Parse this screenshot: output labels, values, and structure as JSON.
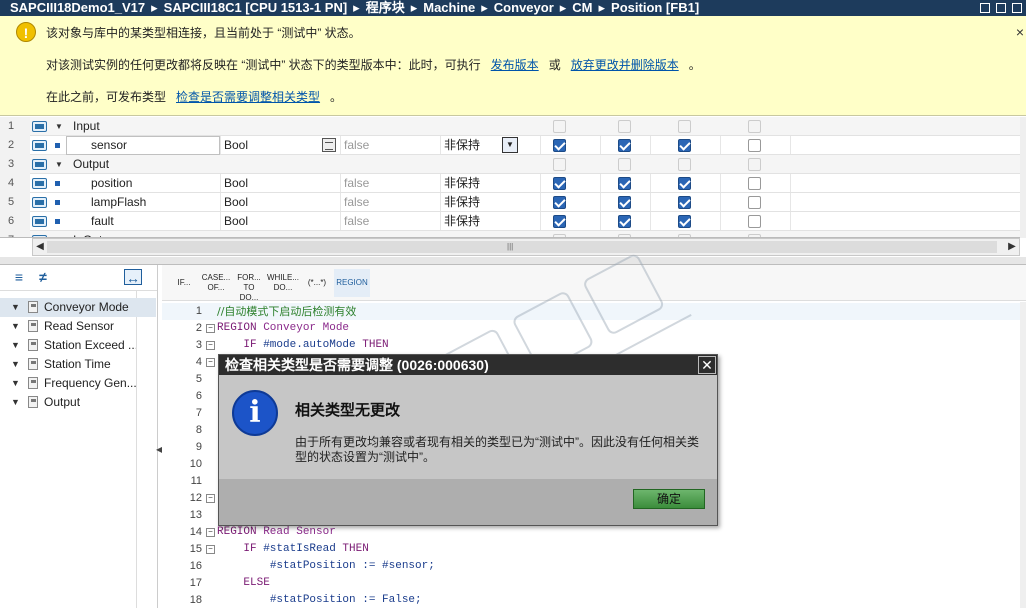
{
  "titlebar": {
    "crumbs": [
      "SAPCIII18Demo1_V17",
      "SAPCIII18C1 [CPU 1513-1 PN]",
      "程序块",
      "Machine",
      "Conveyor",
      "CM",
      "Position [FB1]"
    ],
    "separator": "▸",
    "window_buttons": [
      "minimize",
      "restore",
      "maximize"
    ]
  },
  "banner": {
    "icon": "warning-icon",
    "line1": "该对象与库中的某类型相连接，且当前处于 “测试中” 状态。",
    "line2_text": "对该测试实例的任何更改都将反映在 “测试中” 状态下的类型版本中：此时，可执行",
    "line2_link1": "发布版本",
    "line2_or": "或",
    "line2_link2": "放弃更改并删除版本",
    "line2_end": "。",
    "line3_text": "在此之前，可发布类型",
    "line3_link": "检查是否需要调整相关类型",
    "line3_end": "。",
    "close": "×"
  },
  "interface": {
    "rows": [
      {
        "num": "1",
        "name": "Input",
        "section": true
      },
      {
        "num": "2",
        "name": "sensor",
        "type": "Bool",
        "default": "false",
        "retain": "非保持",
        "checks": [
          true,
          true,
          true
        ],
        "selected": true
      },
      {
        "num": "3",
        "name": "Output",
        "section": true
      },
      {
        "num": "4",
        "name": "position",
        "type": "Bool",
        "default": "false",
        "retain": "非保持",
        "checks": [
          true,
          true,
          true
        ]
      },
      {
        "num": "5",
        "name": "lampFlash",
        "type": "Bool",
        "default": "false",
        "retain": "非保持",
        "checks": [
          true,
          true,
          true
        ]
      },
      {
        "num": "6",
        "name": "fault",
        "type": "Bool",
        "default": "false",
        "retain": "非保持",
        "checks": [
          true,
          true,
          true
        ]
      },
      {
        "num": "7",
        "name": "InOut",
        "section": true
      }
    ],
    "scroll_grip": "|||"
  },
  "nav": {
    "items": [
      "Conveyor Mode",
      "Read Sensor",
      "Station Exceed ...",
      "Station Time",
      "Frequency Gen...",
      "Output"
    ]
  },
  "editor_toolbar": {
    "buttons": [
      {
        "l1": "IF...",
        "l2": ""
      },
      {
        "l1": "CASE...",
        "l2": "OF..."
      },
      {
        "l1": "FOR...",
        "l2": "TO DO..."
      },
      {
        "l1": "WHILE...",
        "l2": "DO..."
      },
      {
        "l1": "(*...*)",
        "l2": ""
      }
    ],
    "region_label": "REGION"
  },
  "code": {
    "lines": [
      {
        "n": "1",
        "fold": false,
        "parts": [
          [
            "cm",
            "//自动模式下启动后检测有效"
          ]
        ]
      },
      {
        "n": "2",
        "fold": true,
        "parts": [
          [
            "kw",
            "REGION"
          ],
          [
            "rg",
            " Conveyor Mode"
          ]
        ]
      },
      {
        "n": "3",
        "fold": true,
        "parts": [
          [
            "",
            "    "
          ],
          [
            "kw",
            "IF"
          ],
          [
            "id",
            " #mode.autoMode"
          ],
          [
            "kw",
            " THEN"
          ]
        ]
      },
      {
        "n": "4",
        "fold": true,
        "parts": []
      },
      {
        "n": "5",
        "fold": false,
        "parts": []
      },
      {
        "n": "6",
        "fold": false,
        "parts": []
      },
      {
        "n": "7",
        "fold": false,
        "parts": []
      },
      {
        "n": "8",
        "fold": false,
        "parts": []
      },
      {
        "n": "9",
        "fold": false,
        "parts": []
      },
      {
        "n": "10",
        "fold": false,
        "parts": []
      },
      {
        "n": "11",
        "fold": false,
        "parts": []
      },
      {
        "n": "12",
        "fold": true,
        "parts": []
      },
      {
        "n": "13",
        "fold": false,
        "parts": []
      },
      {
        "n": "14",
        "fold": true,
        "parts": [
          [
            "kw",
            "REGION"
          ],
          [
            "rg",
            " Read Sensor"
          ]
        ]
      },
      {
        "n": "15",
        "fold": true,
        "parts": [
          [
            "",
            "    "
          ],
          [
            "kw",
            "IF"
          ],
          [
            "id",
            " #statIsRead"
          ],
          [
            "kw",
            " THEN"
          ]
        ]
      },
      {
        "n": "16",
        "fold": false,
        "parts": [
          [
            "",
            "        "
          ],
          [
            "id",
            "#statPosition := #sensor;"
          ]
        ]
      },
      {
        "n": "17",
        "fold": false,
        "parts": [
          [
            "",
            "    "
          ],
          [
            "kw",
            "ELSE"
          ]
        ]
      },
      {
        "n": "18",
        "fold": false,
        "parts": [
          [
            "",
            "        "
          ],
          [
            "id",
            "#statPosition := False;"
          ]
        ]
      }
    ]
  },
  "dialog": {
    "title": "检查相关类型是否需要调整 (0026:000630)",
    "close": "✕",
    "icon": "info-icon",
    "icon_glyph": "i",
    "heading": "相关类型无更改",
    "message": "由于所有更改均兼容或者现有相关的类型已为“测试中”。因此没有任何相关类型的状态设置为“测试中”。",
    "ok_label": "确定"
  },
  "colors": {
    "titlebar": "#1d3b5c",
    "banner": "#ffffc8",
    "checkbox_checked": "#2b66b5",
    "keyword": "#7a1a73",
    "comment": "#2a7f2a",
    "ok_button": "#4a9e4a"
  }
}
